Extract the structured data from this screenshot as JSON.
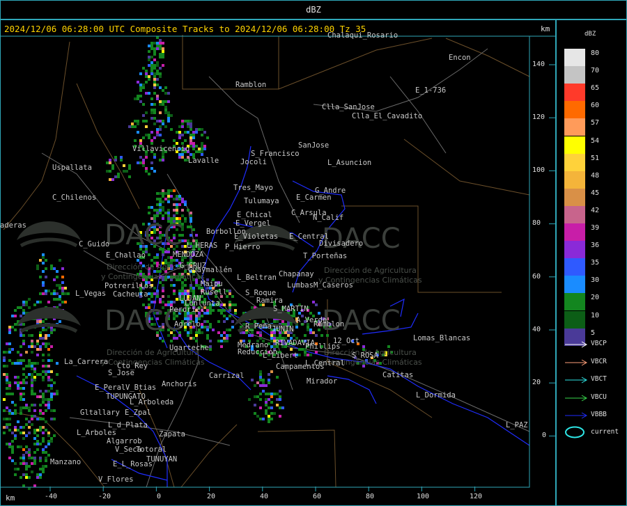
{
  "title": "dBZ",
  "header": "2024/12/06 06:28:00 UTC Composite Tracks to 2024/12/06 06:28:00 Tz 35",
  "axis_unit": "km",
  "y_ticks": [
    "140",
    "120",
    "100",
    "80",
    "60",
    "40",
    "20",
    "0"
  ],
  "x_ticks": [
    "-40",
    "-20",
    "0",
    "20",
    "40",
    "60",
    "80",
    "100",
    "120"
  ],
  "legend": {
    "unit": "dBZ",
    "levels": [
      {
        "label": "80",
        "color": "#e6e6e6"
      },
      {
        "label": "70",
        "color": "#c4c4c4"
      },
      {
        "label": "65",
        "color": "#ff3a2a"
      },
      {
        "label": "60",
        "color": "#ff6a00"
      },
      {
        "label": "57",
        "color": "#ff9b5a"
      },
      {
        "label": "54",
        "color": "#ffff00"
      },
      {
        "label": "51",
        "color": "#ffd23a"
      },
      {
        "label": "48",
        "color": "#f4b43a"
      },
      {
        "label": "45",
        "color": "#d99047"
      },
      {
        "label": "42",
        "color": "#c8648c"
      },
      {
        "label": "39",
        "color": "#c81ea8"
      },
      {
        "label": "36",
        "color": "#8a2ad8"
      },
      {
        "label": "35",
        "color": "#2f5aff"
      },
      {
        "label": "30",
        "color": "#1a8cff"
      },
      {
        "label": "20",
        "color": "#13861f"
      },
      {
        "label": "10",
        "color": "#0c5e16"
      },
      {
        "label": "5",
        "color": "#4a3a98"
      }
    ],
    "tracks": [
      {
        "label": "VBCP",
        "color": "#ffffff"
      },
      {
        "label": "VBCR",
        "color": "#ffa07a"
      },
      {
        "label": "VBCT",
        "color": "#2ee6e6"
      },
      {
        "label": "VBCU",
        "color": "#37d64b"
      },
      {
        "label": "VBBB",
        "color": "#1f2dff"
      }
    ],
    "current_label": "current",
    "current_color": "#2ee6e6"
  },
  "watermark": {
    "logo_text": "DACC",
    "line1": "Dirección de Agricultura",
    "line2": "y Contingencias Climáticas"
  },
  "places": [
    "Chalaqui_Rosario",
    "Encon",
    "Ramblon",
    "E_1-736",
    "Clla_SanJose",
    "Clla_El_Cavadito",
    "SanJose",
    "S_Francisco",
    "Jocoli",
    "L_Asuncion",
    "Uspallata",
    "Villavicencio",
    "Lavalle",
    "Tres_Mayo",
    "G_Andre",
    "Tulumaya",
    "E_Carmen",
    "C_Chilenos",
    "C_Arsula",
    "E_Chical",
    "N_Calif",
    "E_Vergel",
    "Borbollon",
    "E_Violetas",
    "E_Central",
    "P_Hierro",
    "Divisadero",
    "C_Guido",
    "L_HERAS",
    "E_Challao",
    "MENDOZA",
    "T_Porteñas",
    "G_CRUZ",
    "Chapanay",
    "Guaymallén",
    "Maipu",
    "L_Beltran",
    "Potrerillos",
    "Rusell",
    "Lumbas",
    "M_Caseros",
    "Cacheuta",
    "S_Roque",
    "L_Vegas",
    "LUJAN",
    "Ramira",
    "Lunlunta",
    "S_MARTIN",
    "Perdriel",
    "A_Verde",
    "Agrelo",
    "R_Peña",
    "JUNIN",
    "Ramblon",
    "RIVADAVIA",
    "Phillips",
    "12_Oct",
    "Lomas_Blancas",
    "Ugarteche",
    "Medrano",
    "Reducción",
    "L_Libert",
    "L_Central",
    "S_ROSA",
    "La_Carrera",
    "Campamentos",
    "Cto_Rey",
    "S_Jose",
    "Carrizal",
    "Catitas",
    "Mirador",
    "E_Peral",
    "V_Btias",
    "Anchoris",
    "TUPUNGATO",
    "L_Dormida",
    "L_Arboleda",
    "Gltallary",
    "E_Zpal",
    "L_PAZ",
    "L_d_Plata",
    "L_Arboles",
    "Zapata",
    "Algarrob",
    "V_Seca",
    "Totoral",
    "TUNUYAN",
    "E_L_Rosas",
    "Manzano",
    "V_Flores",
    "aderas"
  ]
}
